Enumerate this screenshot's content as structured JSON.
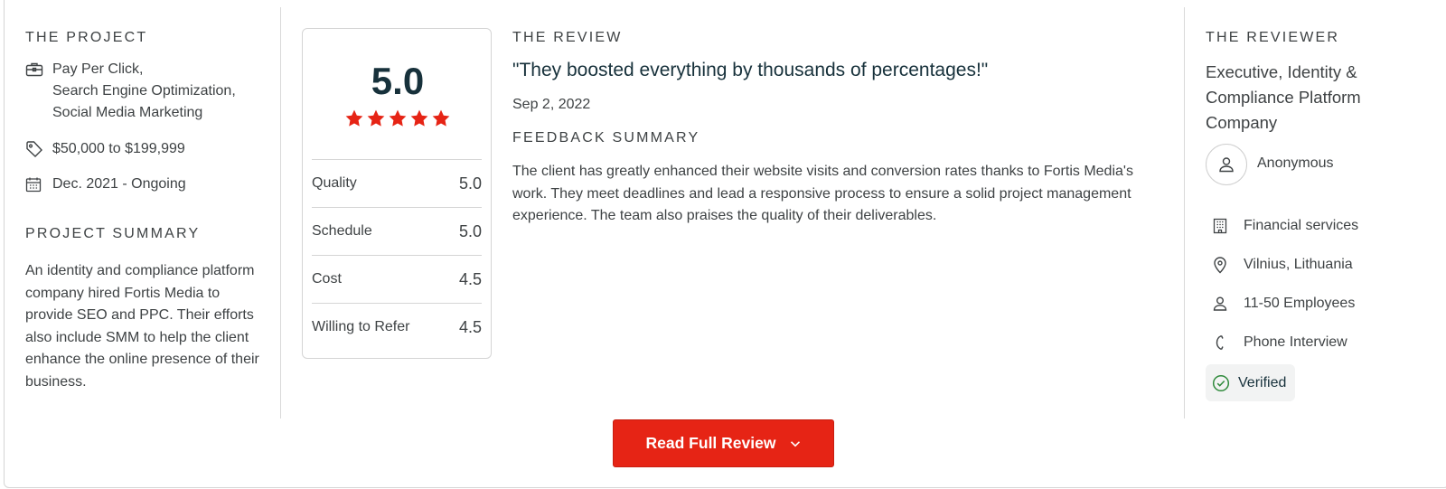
{
  "project": {
    "heading": "THE PROJECT",
    "services": [
      "Pay Per Click,",
      "Search Engine Optimization,",
      "Social Media Marketing"
    ],
    "budget": "$50,000 to $199,999",
    "dates": "Dec. 2021 - Ongoing",
    "summary_heading": "PROJECT SUMMARY",
    "summary": "An identity and compliance platform company hired Fortis Media to provide SEO and PPC. Their efforts also include SMM to help the client enhance the online presence of their business."
  },
  "rating": {
    "overall": "5.0",
    "stars": 5,
    "star_color": "#e62415",
    "rows": [
      {
        "label": "Quality",
        "value": "5.0"
      },
      {
        "label": "Schedule",
        "value": "5.0"
      },
      {
        "label": "Cost",
        "value": "4.5"
      },
      {
        "label": "Willing to Refer",
        "value": "4.5"
      }
    ]
  },
  "review": {
    "heading": "THE REVIEW",
    "quote": "\"They boosted everything by thousands of percentages!\"",
    "date": "Sep 2, 2022",
    "feedback_heading": "FEEDBACK SUMMARY",
    "feedback": "The client has greatly enhanced their website visits and conversion rates thanks to Fortis Media's work. They meet deadlines and lead a responsive process to ensure a solid project management experience. The team also praises the quality of their deliverables."
  },
  "reviewer": {
    "heading": "THE REVIEWER",
    "title": "Executive, Identity & Compliance Platform Company",
    "name": "Anonymous",
    "industry": "Financial services",
    "location": "Vilnius, Lithuania",
    "size": "11-50 Employees",
    "interview": "Phone Interview",
    "verified": "Verified",
    "verified_color": "#2f8a3b"
  },
  "actions": {
    "read_full_review": "Read Full Review",
    "button_color": "#e62415"
  }
}
